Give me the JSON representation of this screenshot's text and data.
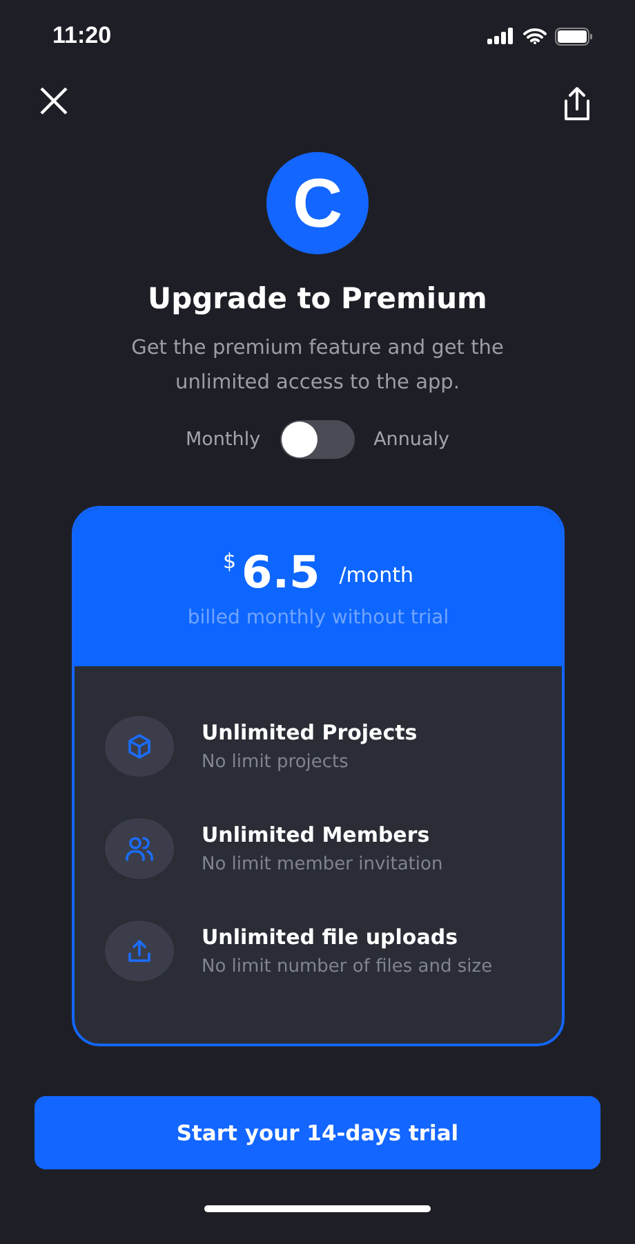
{
  "status_bar": {
    "time": "11:20"
  },
  "logo": {
    "letter": "C"
  },
  "title": "Upgrade to Premium",
  "subtitle": "Get the premium feature and get the unlimited access to the app.",
  "billing": {
    "left_label": "Monthly",
    "right_label": "Annualy",
    "on": false
  },
  "plan": {
    "currency": "$",
    "amount": "6.5",
    "period": "/month",
    "note": "billed monthly without trial"
  },
  "features": [
    {
      "kind": "cube",
      "title": "Unlimited Projects",
      "description": "No limit projects"
    },
    {
      "kind": "users",
      "title": "Unlimited Members",
      "description": "No limit member invitation"
    },
    {
      "kind": "upload",
      "title": "Unlimited file uploads",
      "description": "No limit number of files and size"
    }
  ],
  "cta": "Start your 14-days trial"
}
